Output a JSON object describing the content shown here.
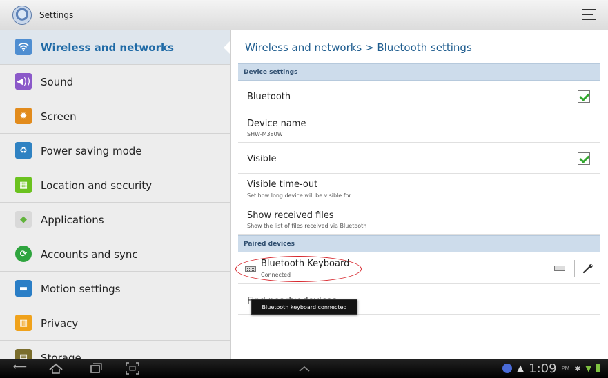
{
  "header": {
    "title": "Settings",
    "menu_icon": "overflow-menu-icon"
  },
  "sidebar": {
    "items": [
      {
        "label": "Wireless and networks",
        "icon": "wifi-icon",
        "color": "#4f8ed1"
      },
      {
        "label": "Sound",
        "icon": "speaker-icon",
        "color": "#8b59c9"
      },
      {
        "label": "Screen",
        "icon": "brightness-icon",
        "color": "#e28b1c"
      },
      {
        "label": "Power saving mode",
        "icon": "battery-icon",
        "color": "#2f82c2"
      },
      {
        "label": "Location and security",
        "icon": "location-grid-icon",
        "color": "#6bc21f"
      },
      {
        "label": "Applications",
        "icon": "android-icon",
        "color": "#61b33b"
      },
      {
        "label": "Accounts and sync",
        "icon": "sync-icon",
        "color": "#2ea43e"
      },
      {
        "label": "Motion settings",
        "icon": "motion-icon",
        "color": "#2a7ec6"
      },
      {
        "label": "Privacy",
        "icon": "privacy-icon",
        "color": "#f0a21b"
      },
      {
        "label": "Storage",
        "icon": "sd-card-icon",
        "color": "#7a6d2c"
      }
    ]
  },
  "main": {
    "breadcrumb": "Wireless and networks  >  Bluetooth settings",
    "sections": {
      "device_settings": "Device settings",
      "paired_devices": "Paired devices"
    },
    "rows": {
      "bluetooth": {
        "title": "Bluetooth",
        "checked": true
      },
      "device_name": {
        "title": "Device name",
        "subtitle": "SHW-M380W"
      },
      "visible": {
        "title": "Visible",
        "checked": true
      },
      "visible_timeout": {
        "title": "Visible time-out",
        "subtitle": "Set how long device will be visible for"
      },
      "show_received": {
        "title": "Show received files",
        "subtitle": "Show the list of files received via Bluetooth"
      },
      "paired_keyboard": {
        "title": "Bluetooth Keyboard",
        "subtitle": "Connected"
      },
      "find_nearby": {
        "title": "Find nearby devices"
      }
    },
    "toast": "Bluetooth keyboard connected"
  },
  "navbar": {
    "time": "1:09",
    "ampm": "PM"
  },
  "colors": {
    "accent": "#1f6aa6",
    "section_header": "#cddceb",
    "annotation": "#d7262c"
  }
}
